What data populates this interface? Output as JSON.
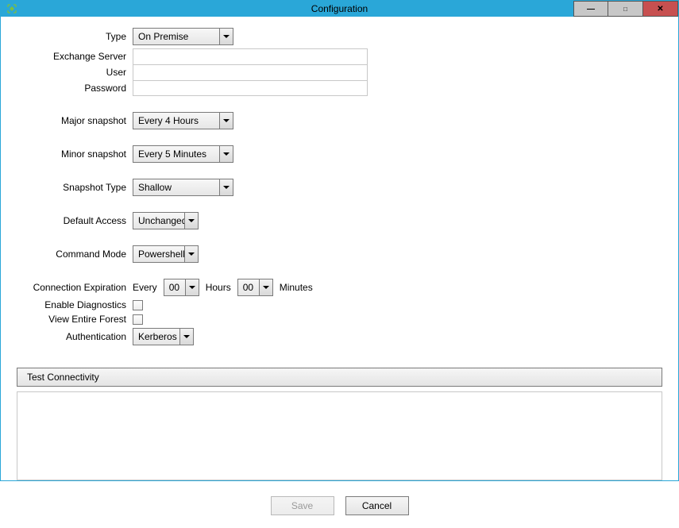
{
  "window": {
    "title": "Configuration"
  },
  "labels": {
    "type": "Type",
    "exchange_server": "Exchange Server",
    "user": "User",
    "password": "Password",
    "major_snapshot": "Major snapshot",
    "minor_snapshot": "Minor snapshot",
    "snapshot_type": "Snapshot Type",
    "default_access": "Default Access",
    "command_mode": "Command Mode",
    "connection_expiration": "Connection Expiration",
    "enable_diagnostics": "Enable Diagnostics",
    "view_entire_forest": "View Entire Forest",
    "authentication": "Authentication",
    "every": "Every",
    "hours": "Hours",
    "minutes": "Minutes"
  },
  "values": {
    "type": "On Premise",
    "exchange_server": "",
    "user": "",
    "password": "",
    "major_snapshot": "Every 4 Hours",
    "minor_snapshot": "Every 5 Minutes",
    "snapshot_type": "Shallow",
    "default_access": "Unchanged",
    "command_mode": "Powershell",
    "conn_exp_hours": "00",
    "conn_exp_minutes": "00",
    "enable_diagnostics": false,
    "view_entire_forest": false,
    "authentication": "Kerberos"
  },
  "buttons": {
    "test_connectivity": "Test Connectivity",
    "save": "Save",
    "cancel": "Cancel"
  }
}
